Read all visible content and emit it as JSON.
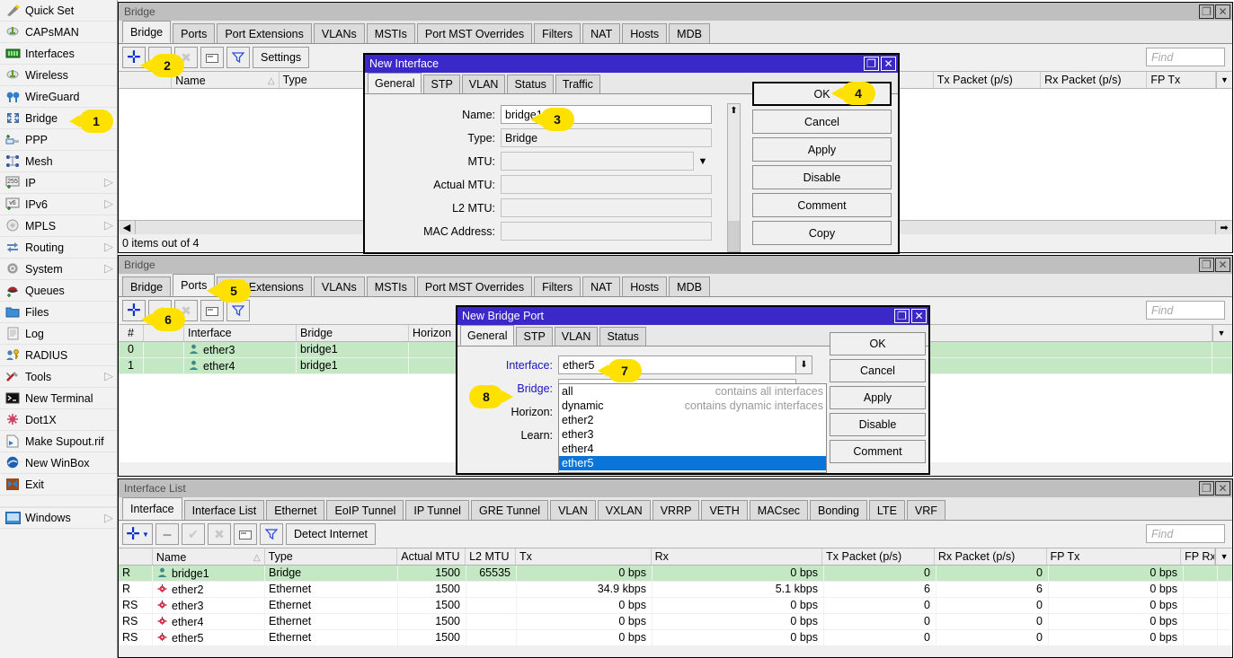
{
  "sidebar": {
    "items": [
      {
        "label": "Quick Set",
        "icon": "wand-icon",
        "arrow": false
      },
      {
        "label": "CAPsMAN",
        "icon": "capsman-icon",
        "arrow": false
      },
      {
        "label": "Interfaces",
        "icon": "interfaces-icon",
        "arrow": false
      },
      {
        "label": "Wireless",
        "icon": "wireless-icon",
        "arrow": false
      },
      {
        "label": "WireGuard",
        "icon": "wireguard-icon",
        "arrow": false
      },
      {
        "label": "Bridge",
        "icon": "bridge-icon",
        "arrow": false
      },
      {
        "label": "PPP",
        "icon": "ppp-icon",
        "arrow": false
      },
      {
        "label": "Mesh",
        "icon": "mesh-icon",
        "arrow": false
      },
      {
        "label": "IP",
        "icon": "ip-icon",
        "arrow": true
      },
      {
        "label": "IPv6",
        "icon": "ipv6-icon",
        "arrow": true
      },
      {
        "label": "MPLS",
        "icon": "mpls-icon",
        "arrow": true
      },
      {
        "label": "Routing",
        "icon": "routing-icon",
        "arrow": true
      },
      {
        "label": "System",
        "icon": "system-icon",
        "arrow": true
      },
      {
        "label": "Queues",
        "icon": "queues-icon",
        "arrow": false
      },
      {
        "label": "Files",
        "icon": "files-icon",
        "arrow": false
      },
      {
        "label": "Log",
        "icon": "log-icon",
        "arrow": false
      },
      {
        "label": "RADIUS",
        "icon": "radius-icon",
        "arrow": false
      },
      {
        "label": "Tools",
        "icon": "tools-icon",
        "arrow": true
      },
      {
        "label": "New Terminal",
        "icon": "terminal-icon",
        "arrow": false
      },
      {
        "label": "Dot1X",
        "icon": "dot1x-icon",
        "arrow": false
      },
      {
        "label": "Make Supout.rif",
        "icon": "supout-icon",
        "arrow": false
      },
      {
        "label": "New WinBox",
        "icon": "winbox-icon",
        "arrow": false
      },
      {
        "label": "Exit",
        "icon": "exit-icon",
        "arrow": false
      }
    ],
    "windows_label": "Windows"
  },
  "bridge_window_top": {
    "title": "Bridge",
    "tabs": [
      "Bridge",
      "Ports",
      "Port Extensions",
      "VLANs",
      "MSTIs",
      "Port MST Overrides",
      "Filters",
      "NAT",
      "Hosts",
      "MDB"
    ],
    "active_tab": "Bridge",
    "toolbar": {
      "add": "+",
      "check": "check-icon",
      "x": "x-icon",
      "copy": "copy-icon",
      "filter": "filter-icon",
      "settings": "Settings"
    },
    "find_placeholder": "Find",
    "columns": [
      "",
      "Name",
      "Type",
      "Tx Packet (p/s)",
      "Rx Packet (p/s)",
      "FP Tx"
    ],
    "rows": [],
    "status": "0 items out of 4"
  },
  "new_interface_dialog": {
    "title": "New Interface",
    "tabs": [
      "General",
      "STP",
      "VLAN",
      "Status",
      "Traffic"
    ],
    "active_tab": "General",
    "fields": [
      {
        "label": "Name:",
        "value": "bridge1",
        "type": "text"
      },
      {
        "label": "Type:",
        "value": "Bridge",
        "type": "readonly"
      },
      {
        "label": "MTU:",
        "value": "",
        "type": "dropdown"
      },
      {
        "label": "Actual MTU:",
        "value": "",
        "type": "readonly"
      },
      {
        "label": "L2 MTU:",
        "value": "",
        "type": "readonly"
      },
      {
        "label": "MAC Address:",
        "value": "",
        "type": "readonly"
      }
    ],
    "buttons": [
      "OK",
      "Cancel",
      "Apply",
      "Disable",
      "Comment",
      "Copy"
    ]
  },
  "bridge_window_mid": {
    "title": "Bridge",
    "tabs": [
      "Bridge",
      "Ports",
      "Port Extensions",
      "VLANs",
      "MSTIs",
      "Port MST Overrides",
      "Filters",
      "NAT",
      "Hosts",
      "MDB"
    ],
    "active_tab": "Ports",
    "find_placeholder": "Find",
    "columns": [
      "#",
      "",
      "Interface",
      "Bridge",
      "Horizon"
    ],
    "rows": [
      {
        "num": "0",
        "iface": "ether3",
        "bridge": "bridge1",
        "horizon": ""
      },
      {
        "num": "1",
        "iface": "ether4",
        "bridge": "bridge1",
        "horizon": ""
      }
    ]
  },
  "new_bridge_port_dialog": {
    "title": "New Bridge Port",
    "tabs": [
      "General",
      "STP",
      "VLAN",
      "Status"
    ],
    "active_tab": "General",
    "fields": [
      {
        "label": "Interface:",
        "value": "ether5"
      },
      {
        "label": "Bridge:",
        "value": ""
      },
      {
        "label": "Horizon:",
        "value": ""
      },
      {
        "label": "Learn:",
        "value": ""
      }
    ],
    "buttons": [
      "OK",
      "Cancel",
      "Apply",
      "Disable",
      "Comment"
    ],
    "dropdown": {
      "options": [
        {
          "name": "all",
          "desc": "contains all interfaces",
          "selected": false
        },
        {
          "name": "dynamic",
          "desc": "contains dynamic interfaces",
          "selected": false
        },
        {
          "name": "ether2",
          "desc": "",
          "selected": false
        },
        {
          "name": "ether3",
          "desc": "",
          "selected": false
        },
        {
          "name": "ether4",
          "desc": "",
          "selected": false
        },
        {
          "name": "ether5",
          "desc": "",
          "selected": true
        }
      ]
    }
  },
  "interface_list_window": {
    "title": "Interface List",
    "tabs": [
      "Interface",
      "Interface List",
      "Ethernet",
      "EoIP Tunnel",
      "IP Tunnel",
      "GRE Tunnel",
      "VLAN",
      "VXLAN",
      "VRRP",
      "VETH",
      "MACsec",
      "Bonding",
      "LTE",
      "VRF"
    ],
    "active_tab": "Interface",
    "toolbar": {
      "detect": "Detect Internet"
    },
    "find_placeholder": "Find",
    "columns": [
      "",
      "Name",
      "Type",
      "Actual MTU",
      "L2 MTU",
      "Tx",
      "Rx",
      "Tx Packet (p/s)",
      "Rx Packet (p/s)",
      "FP Tx",
      "FP Rx"
    ],
    "rows": [
      {
        "flag": "R",
        "name": "bridge1",
        "icon": "bridge-row-icon",
        "type": "Bridge",
        "amtu": "1500",
        "l2mtu": "65535",
        "tx": "0 bps",
        "rx": "0 bps",
        "txp": "0",
        "rxp": "0",
        "fptx": "0 bps",
        "highlight": true
      },
      {
        "flag": "R",
        "name": "ether2",
        "icon": "ethernet-row-icon",
        "type": "Ethernet",
        "amtu": "1500",
        "l2mtu": "",
        "tx": "34.9 kbps",
        "rx": "5.1 kbps",
        "txp": "6",
        "rxp": "6",
        "fptx": "0 bps",
        "highlight": false
      },
      {
        "flag": "RS",
        "name": "ether3",
        "icon": "ethernet-row-icon",
        "type": "Ethernet",
        "amtu": "1500",
        "l2mtu": "",
        "tx": "0 bps",
        "rx": "0 bps",
        "txp": "0",
        "rxp": "0",
        "fptx": "0 bps",
        "highlight": false
      },
      {
        "flag": "RS",
        "name": "ether4",
        "icon": "ethernet-row-icon",
        "type": "Ethernet",
        "amtu": "1500",
        "l2mtu": "",
        "tx": "0 bps",
        "rx": "0 bps",
        "txp": "0",
        "rxp": "0",
        "fptx": "0 bps",
        "highlight": false
      },
      {
        "flag": "RS",
        "name": "ether5",
        "icon": "ethernet-row-icon",
        "type": "Ethernet",
        "amtu": "1500",
        "l2mtu": "",
        "tx": "0 bps",
        "rx": "0 bps",
        "txp": "0",
        "rxp": "0",
        "fptx": "0 bps",
        "highlight": false
      }
    ]
  },
  "callouts": [
    {
      "n": "1",
      "side": "left"
    },
    {
      "n": "2",
      "side": "left"
    },
    {
      "n": "3",
      "side": "left"
    },
    {
      "n": "4",
      "side": "left"
    },
    {
      "n": "5",
      "side": "left"
    },
    {
      "n": "6",
      "side": "left"
    },
    {
      "n": "7",
      "side": "left"
    },
    {
      "n": "8",
      "side": "right"
    }
  ],
  "colors": {
    "dialog_title": "#3a28c8",
    "callout": "#ffe100",
    "row_highlight": "#c3e8c3",
    "selection": "#0a74d8",
    "link_label": "#1a13c0"
  }
}
